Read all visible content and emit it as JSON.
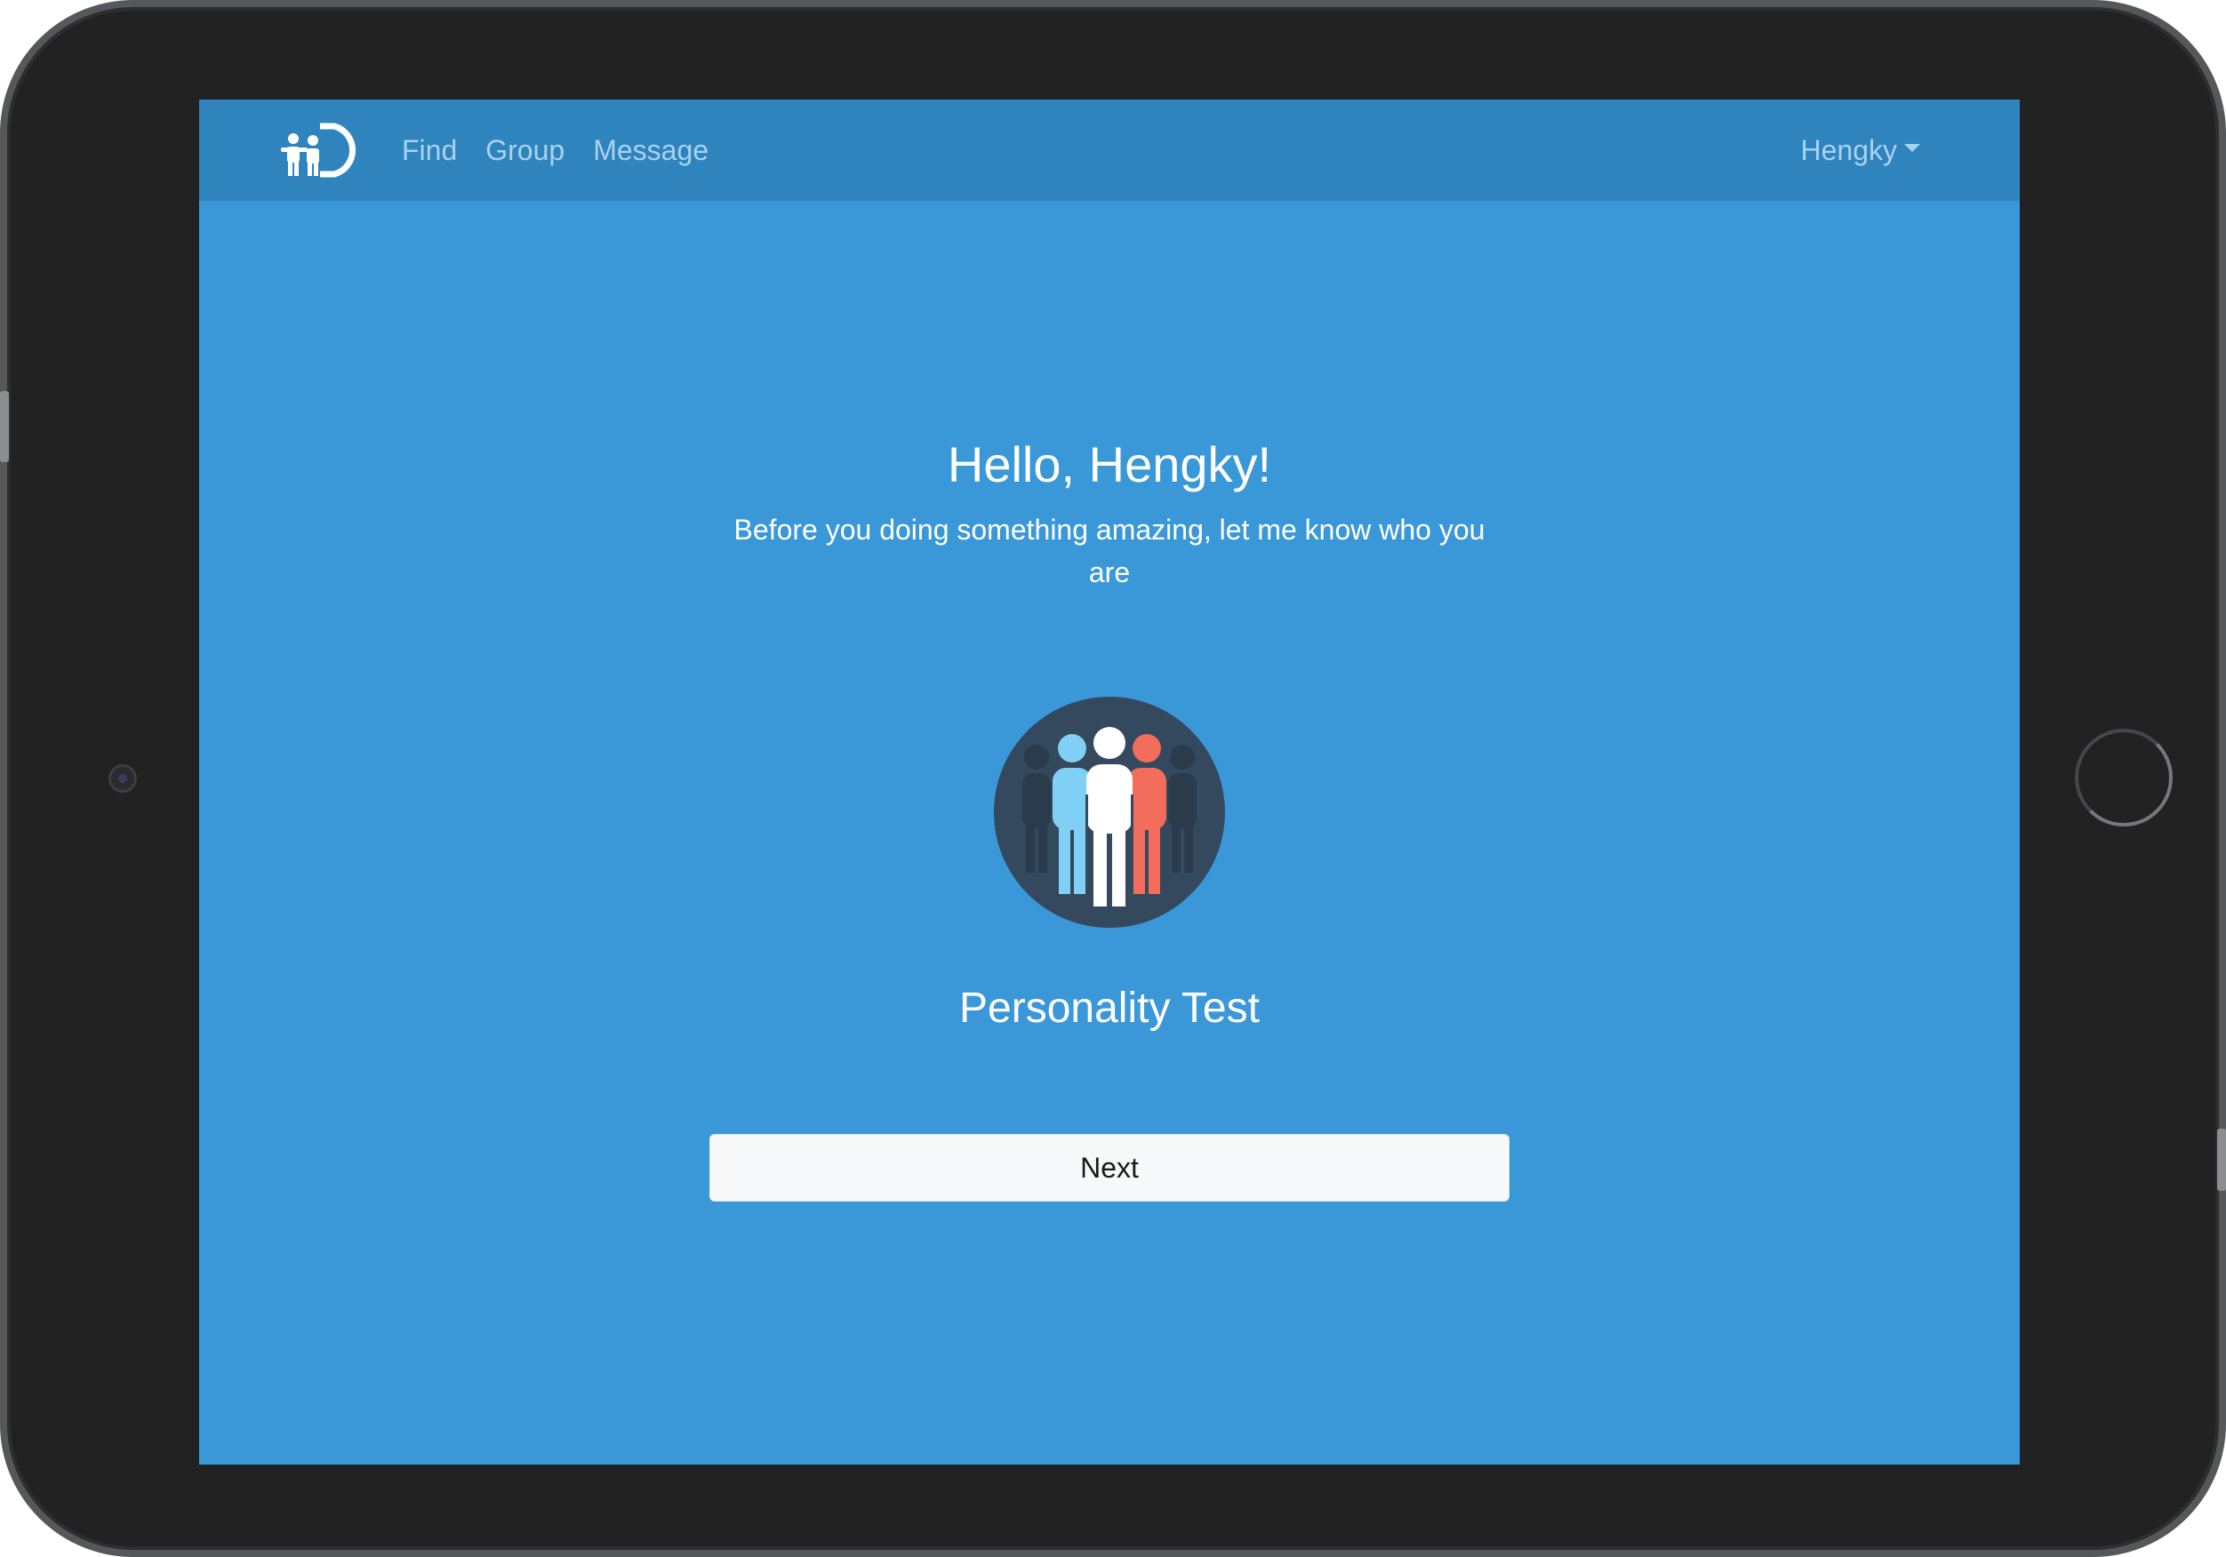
{
  "navbar": {
    "logo_icon": "family-logo-icon",
    "links": [
      "Find",
      "Group",
      "Message"
    ],
    "user": {
      "name": "Hengky",
      "caret_icon": "caret-down-icon"
    }
  },
  "main": {
    "greeting": "Hello, Hengky!",
    "intro": "Before you doing something amazing, let me know who you are",
    "illustration_icon": "people-group-icon",
    "test_title": "Personality Test",
    "next_label": "Next"
  },
  "colors": {
    "screen_background": "#3a98d9",
    "navbar_background": "#2f84bd",
    "nav_link": "#a8d2f0",
    "illustration_circle": "#34495e",
    "figure_light_blue": "#80d0f5",
    "figure_white": "#ffffff",
    "figure_red": "#f26d5b",
    "button_background": "#f7f8fa",
    "bezel": "#222223"
  }
}
